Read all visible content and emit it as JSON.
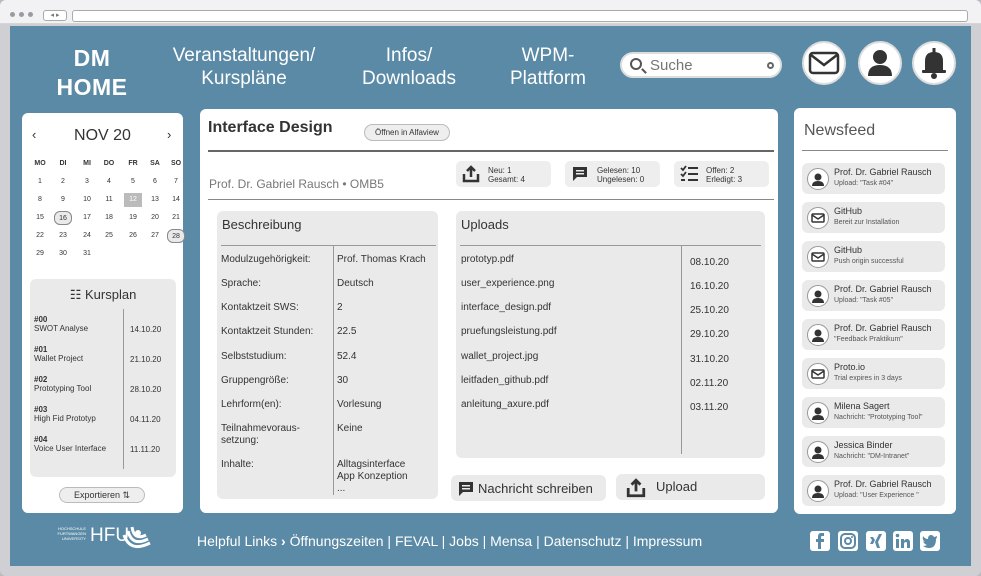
{
  "header": {
    "logo_line1": "DM",
    "logo_line2": "HOME",
    "nav": [
      {
        "line1": "Veranstaltungen/",
        "line2": "Kurspläne"
      },
      {
        "line1": "Infos/",
        "line2": "Downloads"
      },
      {
        "line1": "WPM-",
        "line2": "Plattform"
      }
    ],
    "search_placeholder": "Suche"
  },
  "calendar": {
    "month": "NOV 20",
    "weekdays": [
      "MO",
      "DI",
      "MI",
      "DO",
      "FR",
      "SA",
      "SO"
    ],
    "weeks": [
      [
        "1",
        "2",
        "3",
        "4",
        "5",
        "6",
        "7"
      ],
      [
        "8",
        "9",
        "10",
        "11",
        "12",
        "13",
        "14"
      ],
      [
        "15",
        "16",
        "17",
        "18",
        "19",
        "20",
        "21"
      ],
      [
        "22",
        "23",
        "24",
        "25",
        "26",
        "27",
        "28"
      ],
      [
        "29",
        "30",
        "31",
        "",
        "",
        "",
        ""
      ]
    ]
  },
  "kursplan": {
    "title": "Kursplan",
    "items": [
      {
        "num": "#00",
        "name": "SWOT Analyse",
        "date": "14.10.20"
      },
      {
        "num": "#01",
        "name": "Wallet Project",
        "date": "21.10.20"
      },
      {
        "num": "#02",
        "name": "Prototyping Tool",
        "date": "28.10.20"
      },
      {
        "num": "#03",
        "name": "High Fid Prototyp",
        "date": "04.11.20"
      },
      {
        "num": "#04",
        "name": "Voice User Interface",
        "date": "11.11.20"
      }
    ],
    "export_label": "Exportieren"
  },
  "course": {
    "title": "Interface Design",
    "open_button": "Öffnen in Alfaview",
    "lecturer": "Prof. Dr. Gabriel Rausch • OMB5",
    "stats": [
      {
        "line1": "Neu: 1",
        "line2": "Gesamt: 4"
      },
      {
        "line1": "Gelesen: 10",
        "line2": "Ungelesen: 0"
      },
      {
        "line1": "Offen: 2",
        "line2": "Erledigt: 3"
      }
    ],
    "description": {
      "title": "Beschreibung",
      "rows": [
        {
          "k": "Modulzugehörigkeit:",
          "v": "Prof. Thomas Krach"
        },
        {
          "k": "Sprache:",
          "v": "Deutsch"
        },
        {
          "k": "Kontaktzeit SWS:",
          "v": "2"
        },
        {
          "k": "Kontaktzeit Stunden:",
          "v": "22.5"
        },
        {
          "k": "Selbststudium:",
          "v": "52.4"
        },
        {
          "k": "Gruppengröße:",
          "v": "30"
        },
        {
          "k": "Lehrform(en):",
          "v": "Vorlesung"
        },
        {
          "k": "Teilnahmevoraus-\nsetzung:",
          "v": "Keine"
        },
        {
          "k": "Inhalte:",
          "v": "Alltagsinterface\nApp Konzeption\n..."
        }
      ]
    },
    "uploads": {
      "title": "Uploads",
      "files": [
        {
          "name": "prototyp.pdf",
          "date": "08.10.20"
        },
        {
          "name": "user_experience.png",
          "date": "16.10.20"
        },
        {
          "name": "interface_design.pdf",
          "date": "25.10.20"
        },
        {
          "name": "pruefungsleistung.pdf",
          "date": "29.10.20"
        },
        {
          "name": "wallet_project.jpg",
          "date": "31.10.20"
        },
        {
          "name": "leitfaden_github.pdf",
          "date": "02.11.20"
        },
        {
          "name": "anleitung_axure.pdf",
          "date": "03.11.20"
        }
      ]
    },
    "message_button": "Nachricht schreiben",
    "upload_button": "Upload"
  },
  "newsfeed": {
    "title": "Newsfeed",
    "items": [
      {
        "icon": "avatar-icon",
        "name": "Prof. Dr. Gabriel Rausch",
        "sub": "Upload: \"Task #04\""
      },
      {
        "icon": "mail-icon",
        "name": "GitHub",
        "sub": "Bereit zur Installation"
      },
      {
        "icon": "mail-icon",
        "name": "GitHub",
        "sub": "Push origin successful"
      },
      {
        "icon": "avatar-icon",
        "name": "Prof. Dr. Gabriel Rausch",
        "sub": "Upload: \"Task #05\""
      },
      {
        "icon": "avatar-icon",
        "name": "Prof. Dr. Gabriel Rausch",
        "sub": "\"Feedback Praktikum\""
      },
      {
        "icon": "mail-icon",
        "name": "Proto.io",
        "sub": "Trial expires in 3 days"
      },
      {
        "icon": "avatar-icon",
        "name": "Milena Sagert",
        "sub": "Nachricht: \"Prototyping Tool\""
      },
      {
        "icon": "avatar-icon",
        "name": "Jessica Binder",
        "sub": "Nachricht: \"DM-Intranet\""
      },
      {
        "icon": "avatar-icon",
        "name": "Prof. Dr. Gabriel Rausch",
        "sub": "Upload: \"User Experience \""
      }
    ]
  },
  "footer": {
    "hfu_small": "HOCHSCHULE\nFURTWANGEN\nUNIVERSITY",
    "hfu": "HFU",
    "helpful": "Helpful Links",
    "links": [
      "Öffnungszeiten",
      "FEVAL",
      "Jobs",
      "Mensa",
      "Datenschutz",
      "Impressum"
    ]
  },
  "colors": {
    "page_bg": "#5a8aa6",
    "panel_bg": "#ffffff",
    "box_bg": "#eaeaea"
  }
}
